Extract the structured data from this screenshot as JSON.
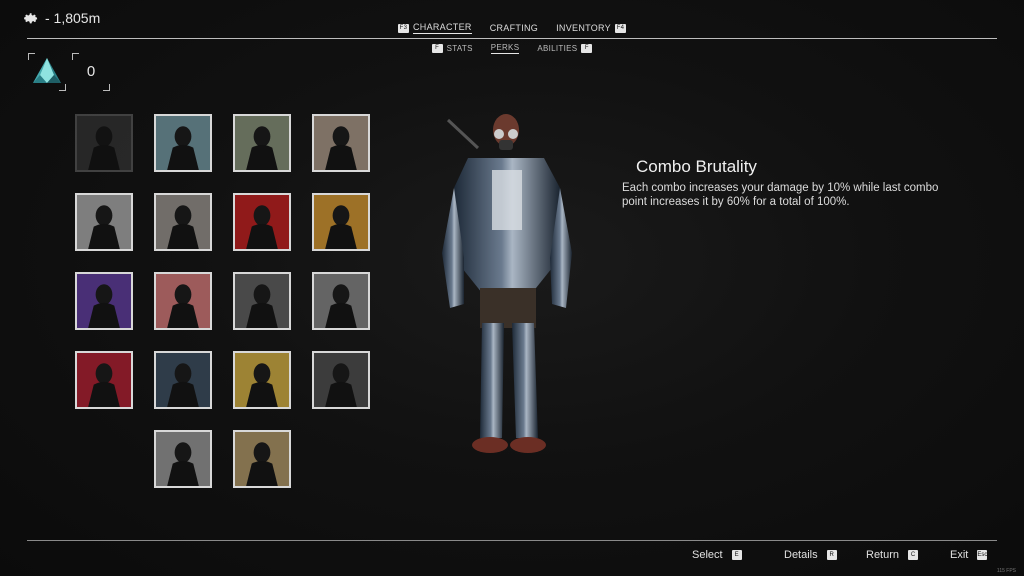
{
  "hud": {
    "depth_label": "- 1,805m"
  },
  "top_tabs": [
    {
      "key": "F3",
      "label": "CHARACTER",
      "active": true
    },
    {
      "label": "CRAFTING"
    },
    {
      "label": "INVENTORY",
      "key": "F4"
    }
  ],
  "sub_tabs": [
    {
      "key": "F",
      "label": "STATS"
    },
    {
      "label": "PERKS",
      "active": true
    },
    {
      "label": "ABILITIES",
      "key": "F"
    }
  ],
  "currency": {
    "amount": "0",
    "icon": "crystal-icon"
  },
  "perks": [
    {
      "name": "perk-1",
      "tint": "#4a4a4a",
      "locked": true
    },
    {
      "name": "perk-2",
      "tint": "#6a8a93"
    },
    {
      "name": "perk-3",
      "tint": "#7c8570"
    },
    {
      "name": "perk-4",
      "tint": "#9a8a7c"
    },
    {
      "name": "perk-5",
      "tint": "#9a9a9a"
    },
    {
      "name": "perk-6",
      "tint": "#8a8680"
    },
    {
      "name": "perk-7",
      "tint": "#b02020"
    },
    {
      "name": "perk-8",
      "tint": "#c08a30"
    },
    {
      "name": "perk-9",
      "tint": "#5a3a90"
    },
    {
      "name": "perk-10",
      "tint": "#c07070"
    },
    {
      "name": "perk-11",
      "tint": "#5a5a5a"
    },
    {
      "name": "perk-12",
      "tint": "#7a7a7a"
    },
    {
      "name": "perk-13",
      "tint": "#a02030"
    },
    {
      "name": "perk-14",
      "tint": "#3a4a5a"
    },
    {
      "name": "perk-15",
      "tint": "#c0a040"
    },
    {
      "name": "perk-16",
      "tint": "#4a4a4a"
    },
    {
      "name": "perk-17",
      "tint": "#8a8a8a"
    },
    {
      "name": "perk-18",
      "tint": "#a08a60"
    }
  ],
  "selected_perk": {
    "title": "Combo Brutality",
    "description": "Each combo increases your damage by 10% while last combo point increases it by 60% for a total of 100%."
  },
  "footer": [
    {
      "label": "Select",
      "key": "E"
    },
    {
      "label": "Details",
      "key": "R"
    },
    {
      "label": "Return",
      "key": "C"
    },
    {
      "label": "Exit",
      "key": "Esc"
    }
  ],
  "fps": "115 FPS"
}
